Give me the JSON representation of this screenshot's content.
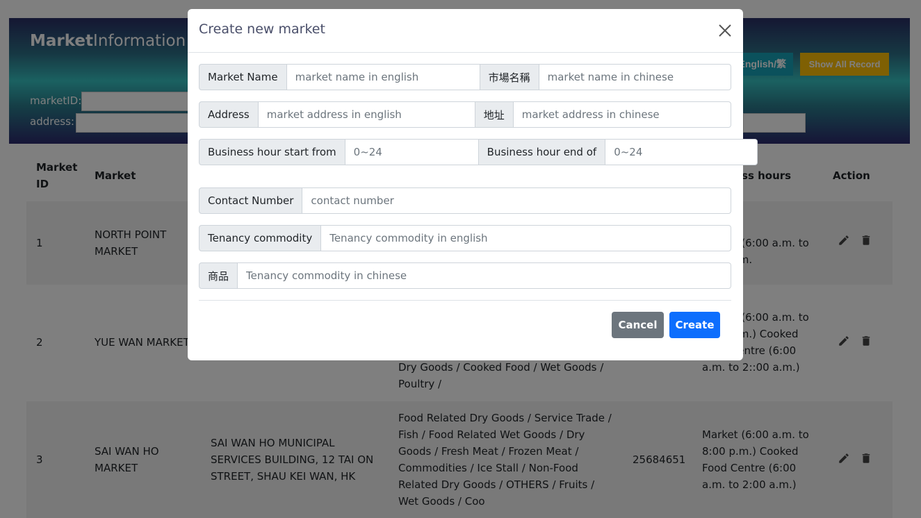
{
  "header": {
    "brand_bold": "Market",
    "brand_rest": "Information",
    "lang_button": "English/繁",
    "show_all_button": "Show All Record",
    "market_id_label": "marketID:",
    "address_label": "address:"
  },
  "table": {
    "headers": {
      "market_id": "Market ID",
      "market": "Market",
      "business_hours": "Business hours",
      "action": "Action"
    },
    "rows": [
      {
        "id": "1",
        "market": "NORTH POINT MARKET",
        "address": "",
        "commodity": "",
        "contact": "",
        "hours": "Market (6:00 a.m. to 8:00 p.m."
      },
      {
        "id": "2",
        "market": "YUE WAN MARKET",
        "address": "",
        "commodity": "Dry Goods / Cooked Food / Wet Goods / Poultry /",
        "contact": "",
        "hours": "Market (6:00 a.m. to 8:00 p.m.) Cooked Food Centre (6:00 a.m. to 2::00 a.m.)"
      },
      {
        "id": "3",
        "market": "SAI WAN HO MARKET",
        "address": "SAI WAN HO MUNICIPAL SERVICES BUILDING, 12 TAI ON STREET, SHAU KEI WAN, HK",
        "commodity": "Food Related Dry Goods / Service Trade / Fish / Food Related Wet Goods / Dry Goods / Fresh Meat / Frozen Meat / Commodities / Ice Stall / Non-Food Related Dry Goods / OTHERS / Fruits / Wet Goods / Coo",
        "contact": "25684651",
        "hours": "Market (6:00 a.m. to 8:00 p.m.) Cooked Food Centre (6:00 a.m. to 2:00 a.m.)"
      }
    ]
  },
  "modal": {
    "title": "Create new market",
    "market_name_label": "Market Name",
    "market_name_placeholder": "market name in english",
    "market_name_cn_label": "市場名稱",
    "market_name_cn_placeholder": "market name in chinese",
    "address_label": "Address",
    "address_placeholder": "market address in english",
    "address_cn_label": "地址",
    "address_cn_placeholder": "market address in chinese",
    "hour_start_label": "Business hour start from",
    "hour_start_placeholder": "0~24",
    "hour_end_label": "Business hour end of",
    "hour_end_placeholder": "0~24",
    "contact_label": "Contact Number",
    "contact_placeholder": "contact number",
    "tenancy_label": "Tenancy commodity",
    "tenancy_placeholder": "Tenancy commodity in english",
    "tenancy_cn_label": "商品",
    "tenancy_cn_placeholder": "Tenancy commodity in chinese",
    "cancel_button": "Cancel",
    "create_button": "Create"
  },
  "colors": {
    "primary": "#0d6efd",
    "secondary": "#6c757d",
    "info": "#17a2b8",
    "warning": "#ffc107"
  }
}
